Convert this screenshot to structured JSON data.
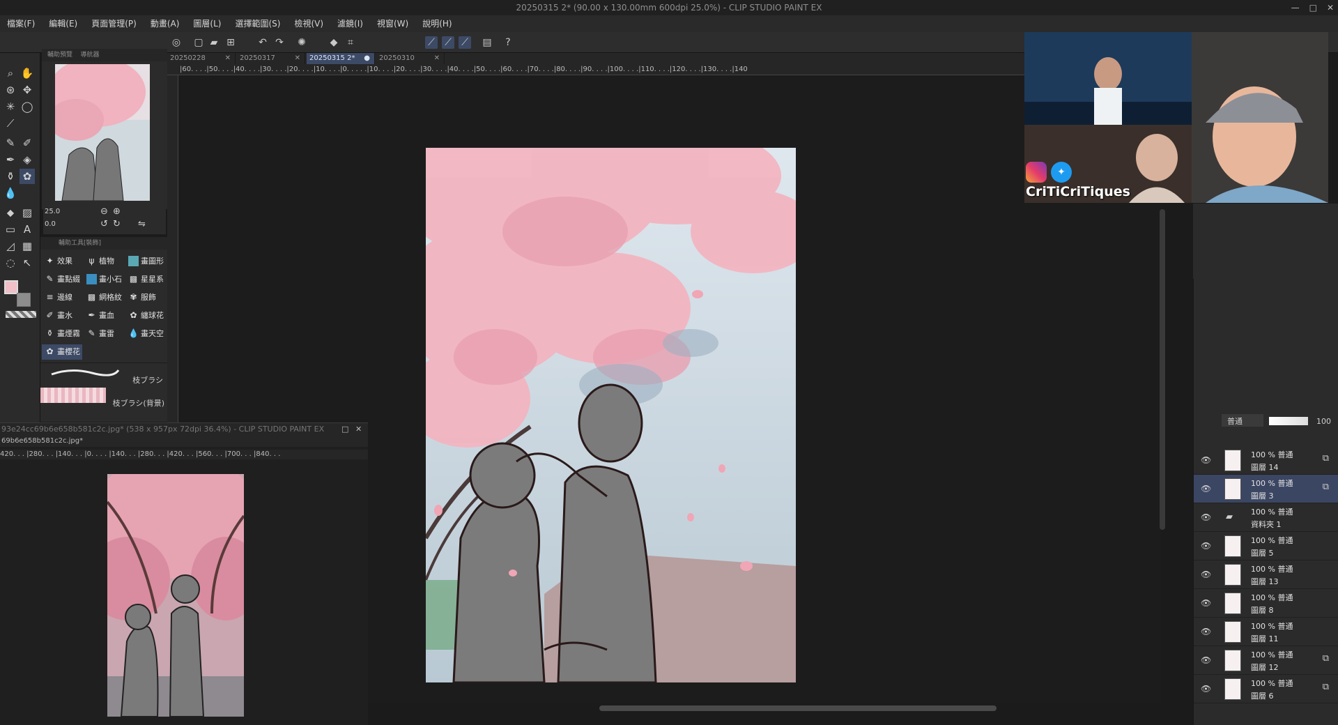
{
  "window": {
    "title": "20250315 2* (90.00 x 130.00mm 600dpi 25.0%) - CLIP STUDIO PAINT EX",
    "controls": [
      "—",
      "□",
      "✕"
    ]
  },
  "menu": [
    "檔案(F)",
    "編輯(E)",
    "頁面管理(P)",
    "動畫(A)",
    "圖層(L)",
    "選擇範圍(S)",
    "檢視(V)",
    "濾鏡(I)",
    "視窗(W)",
    "說明(H)"
  ],
  "tabs": [
    {
      "label": "20250228",
      "close": "✕"
    },
    {
      "label": "20250317",
      "close": "✕"
    },
    {
      "label": "20250315 2*",
      "close": "●"
    },
    {
      "label": "20250310",
      "close": "✕"
    }
  ],
  "ruler_h": "|60. . . .|50. . . .|40. . . .|30. . . .|20. . . .|10. . . .|0. . . . .|10. . . .|20. . . .|30. . . .|40. . . .|50. . . .|60. . . .|70. . . .|80. . . .|90. . . .|100. . . .|110. . . .|120. . . .|130. . . .|140",
  "navigator": {
    "tab1": "輔助預覽",
    "tab2": "導航器",
    "zoom": "25.0",
    "angle": "0.0"
  },
  "subtool": {
    "header": "輔助工具[裝飾]",
    "groups": [
      "效果",
      "植物",
      "畫圖形",
      "畫點綴",
      "畫小石",
      "星星系",
      "邊線",
      "網格紋",
      "服飾",
      "畫水",
      "畫血",
      "纏球花",
      "畫煙霧",
      "畫雷",
      "畫天空",
      "畫櫻花"
    ],
    "brushes": [
      "枝ブラシ",
      "枝ブラシ(背景)"
    ]
  },
  "subwindow": {
    "title": "93e24cc69b6e658b581c2c.jpg* (538 x 957px 72dpi 36.4%) - CLIP STUDIO PAINT EX",
    "tab": "69b6e658b581c2c.jpg*",
    "ruler": "420. . . |280. . . |140. . . |0. . . . |140. . . |280. . . |420. . . |560. . . |700. . . |840. . ."
  },
  "webcam": {
    "channel": "CriTiCriTiques"
  },
  "color": {
    "r": "240",
    "g": "191",
    "b": "199",
    "main": "#f0bfc7",
    "sub": "#8d8d8d",
    "accent": "#3c4a66"
  },
  "layers_header": {
    "blend": "普通",
    "opacity": "100"
  },
  "layers": [
    {
      "mode": "100 % 普通",
      "name": "圖層 14",
      "clip": true
    },
    {
      "mode": "100 % 普通",
      "name": "圖層 3",
      "clip": true,
      "selected": true
    },
    {
      "mode": "100 % 普通",
      "name": "資料夾 1",
      "folder": true
    },
    {
      "mode": "100 % 普通",
      "name": "圖層 5"
    },
    {
      "mode": "100 % 普通",
      "name": "圖層 13"
    },
    {
      "mode": "100 % 普通",
      "name": "圖層 8"
    },
    {
      "mode": "100 % 普通",
      "name": "圖層 11"
    },
    {
      "mode": "100 % 普通",
      "name": "圖層 12",
      "clip": true
    },
    {
      "mode": "100 % 普通",
      "name": "圖層 6",
      "clip": true
    }
  ]
}
